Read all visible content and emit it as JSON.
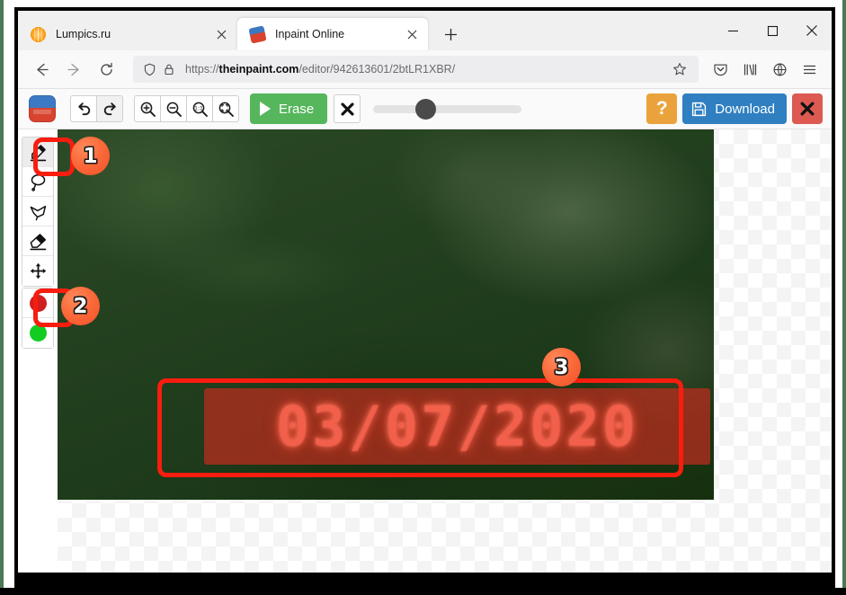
{
  "browser": {
    "tabs": [
      {
        "title": "Lumpics.ru",
        "favicon": "lemon-slice-icon",
        "active": false
      },
      {
        "title": "Inpaint Online",
        "favicon": "inpaint-logo-icon",
        "active": true
      }
    ],
    "new_tab_label": "+",
    "window_controls": {
      "minimize": "—",
      "maximize": "□",
      "close": "✕"
    },
    "nav": {
      "back": "back-arrow-icon",
      "forward": "forward-arrow-icon",
      "reload": "reload-icon",
      "shield": "shield-icon",
      "lock": "lock-icon",
      "bookmark": "star-icon",
      "pocket": "pocket-icon",
      "library": "library-icon",
      "account": "globe-icon",
      "menu": "hamburger-menu-icon"
    },
    "url": {
      "scheme": "https://",
      "domain": "theinpaint.com",
      "path": "/editor/942613601/2btLR1XBR/",
      "full": "https://theinpaint.com/editor/942613601/2btLR1XBR/"
    }
  },
  "app": {
    "logo": "inpaint-logo",
    "toolbar": {
      "undo": "undo-icon",
      "redo": "redo-icon",
      "zoom_in": "zoom-in-icon",
      "zoom_out": "zoom-out-icon",
      "zoom_actual": "zoom-1to1-icon",
      "zoom_fit": "zoom-fit-icon",
      "erase_label": "Erase",
      "cancel": "cancel-x-icon",
      "brush_slider_value": 30,
      "help_label": "?",
      "download_label": "Download",
      "close_label": "close-x-icon"
    },
    "tools": [
      {
        "name": "marker-tool",
        "icon": "marker-icon",
        "active": true
      },
      {
        "name": "lasso-tool",
        "icon": "lasso-icon",
        "active": false
      },
      {
        "name": "polygon-lasso-tool",
        "icon": "polygon-lasso-icon",
        "active": false
      },
      {
        "name": "eraser-tool",
        "icon": "eraser-icon",
        "active": false
      },
      {
        "name": "move-tool",
        "icon": "move-arrows-icon",
        "active": false
      }
    ],
    "swatches": [
      {
        "name": "red-swatch",
        "color": "#cf1f1f",
        "selected": true
      },
      {
        "name": "green-swatch",
        "color": "#13cc22",
        "selected": false
      }
    ]
  },
  "canvas": {
    "date_text": "03/07/2020",
    "mask_color": "#be2d1e"
  },
  "annotations": {
    "badges": [
      {
        "number": "1",
        "target": "marker-tool"
      },
      {
        "number": "2",
        "target": "red-swatch"
      },
      {
        "number": "3",
        "target": "date-selection"
      }
    ],
    "color": "#f81d0f"
  }
}
